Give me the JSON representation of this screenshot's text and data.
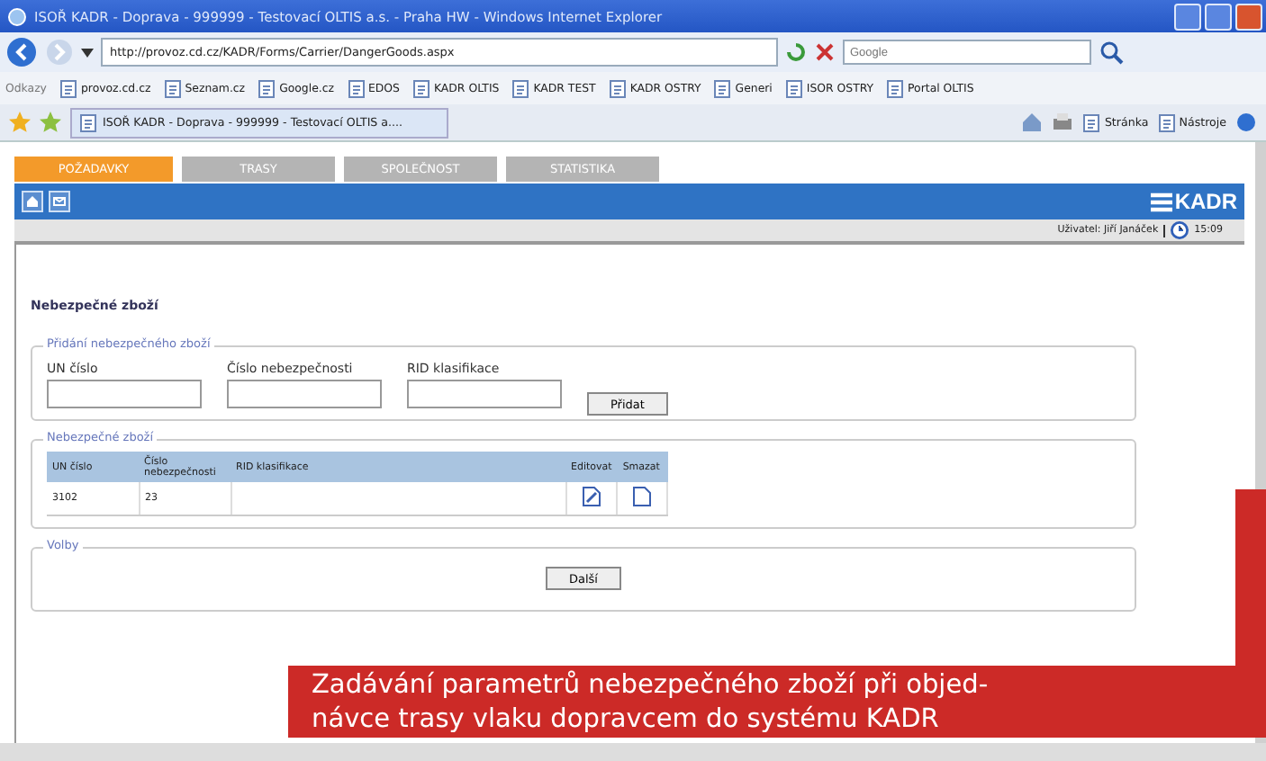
{
  "window": {
    "title": "ISOŘ KADR - Doprava - 999999 - Testovací OLTIS a.s. - Praha HW - Windows Internet Explorer"
  },
  "address_bar": {
    "url": "http://provoz.cd.cz/KADR/Forms/Carrier/DangerGoods.aspx",
    "search_placeholder": "Google"
  },
  "favorites_bar": {
    "label": "Odkazy",
    "links": [
      "provoz.cd.cz",
      "Seznam.cz",
      "Google.cz",
      "EDOS",
      "KADR OLTIS",
      "KADR TEST",
      "KADR OSTRY",
      "Generi",
      "ISOR OSTRY",
      "Portal OLTIS"
    ]
  },
  "browser_tab": {
    "title": "ISOŘ KADR - Doprava - 999999 - Testovací OLTIS a...."
  },
  "command_bar": {
    "items": [
      "Stránka",
      "Nástroje"
    ]
  },
  "app_tabs": [
    {
      "label": "POŽADAVKY",
      "selected": true
    },
    {
      "label": "TRASY",
      "selected": false
    },
    {
      "label": "SPOLEČNOST",
      "selected": false
    },
    {
      "label": "STATISTIKA",
      "selected": false
    }
  ],
  "logo": "KADR",
  "user_bar": {
    "user": "Uživatel: Jiří Janáček",
    "time": "15:09"
  },
  "page_title": "Nebezpečné zboží",
  "add_form": {
    "legend": "Přidání nebezpečného zboží",
    "fields": [
      {
        "label": "UN číslo"
      },
      {
        "label": "Číslo nebezpečnosti"
      },
      {
        "label": "RID klasifikace"
      }
    ],
    "button": "Přidat"
  },
  "goods_table": {
    "legend": "Nebezpečné zboží",
    "columns": [
      "UN číslo",
      "Číslo nebezpečnosti",
      "RID klasifikace",
      "Editovat",
      "Smazat"
    ],
    "rows": [
      {
        "cells": [
          "3102",
          "23",
          ""
        ]
      }
    ]
  },
  "options": {
    "legend": "Volby",
    "button": "Další"
  },
  "caption": "Zadávání parametrů nebezpečného zboží při objed-\nnávce trasy vlaku dopravcem do systému KADR"
}
